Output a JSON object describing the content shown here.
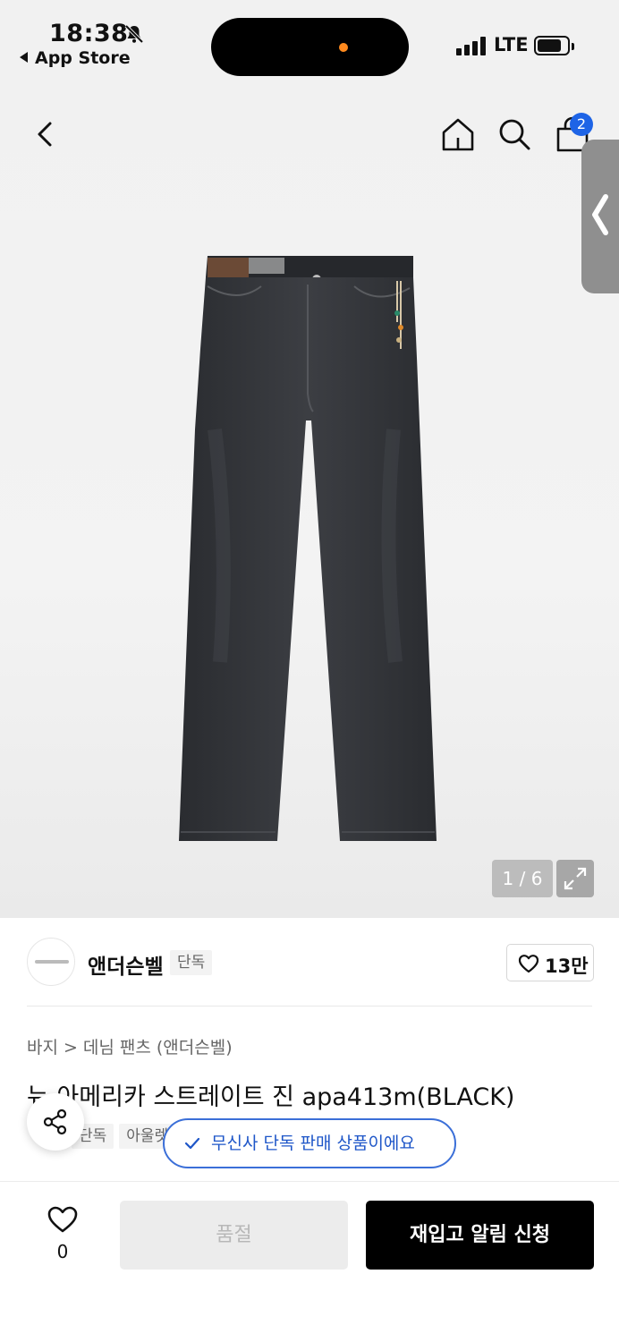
{
  "status_bar": {
    "time": "18:38",
    "back_app": "App Store",
    "network": "LTE"
  },
  "nav": {
    "cart_count": "2"
  },
  "gallery": {
    "counter": "1 / 6"
  },
  "brand": {
    "name": "앤더슨벨",
    "exclusive_tag": "단독",
    "likes": "13만"
  },
  "product": {
    "breadcrumb": [
      "바지",
      "데님 팬츠 (앤더슨벨)"
    ],
    "title": "뉴 아메리카 스트레이트 진 apa413m(BLACK)",
    "tags": [
      "단독",
      "아울렛"
    ]
  },
  "toast": {
    "message": "무신사 단독 판매 상품이에요"
  },
  "bottom_bar": {
    "wish_count": "0",
    "soldout_label": "품절",
    "restock_label": "재입고 알림 신청"
  },
  "colors": {
    "accent_blue": "#1e64e6",
    "primary_button": "#000000",
    "disabled_button": "#ececec"
  }
}
